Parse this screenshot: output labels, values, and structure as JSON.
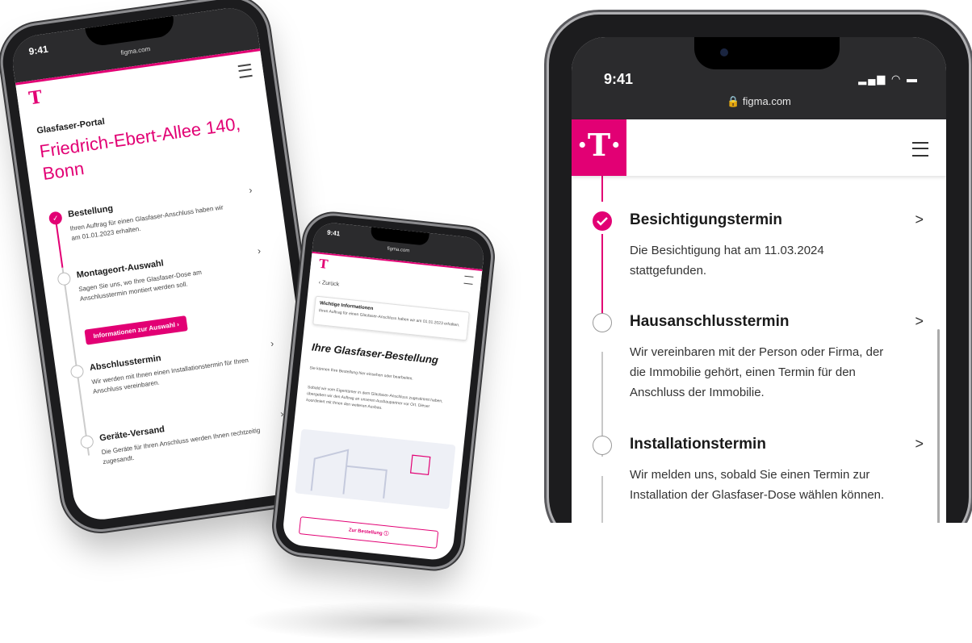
{
  "colors": {
    "brand": "#e20074",
    "frame": "#1c1c1e"
  },
  "phone_left": {
    "time": "9:41",
    "url": "figma.com",
    "portal_label": "Glasfaser-Portal",
    "address": "Friedrich-Ebert-Allee 140, Bonn",
    "steps": [
      {
        "title": "Bestellung",
        "desc": "Ihren Auftrag für einen Glasfaser-Anschluss haben wir am 01.01.2023 erhalten.",
        "status": "done"
      },
      {
        "title": "Montageort-Auswahl",
        "desc": "Sagen Sie uns, wo Ihre Glasfaser-Dose am Anschlusstermin montiert werden soll.",
        "status": "open"
      },
      {
        "title": "Abschlusstermin",
        "desc": "Wir werden mit Ihnen einen Installationstermin für Ihren Anschluss vereinbaren.",
        "status": "open"
      },
      {
        "title": "Geräte-Versand",
        "desc": "Die Geräte für Ihren Anschluss werden Ihnen rechtzeitig zugesandt.",
        "status": "open"
      }
    ],
    "info_button": "Informationen zur Auswahl  ›"
  },
  "phone_middle": {
    "time": "9:41",
    "url": "figma.com",
    "back": "‹  Zurück",
    "info_title": "Wichtige Informationen",
    "info_text": "Ihren Auftrag für einen Glasfaser-Anschluss haben wir am 01.01.2023 erhalten.",
    "heading": "Ihre Glasfaser-Bestellung",
    "para1": "Sie können Ihre Bestellung hier einsehen oder bearbeiten.",
    "para2": "Sobald wir vom Eigentümer in dem Glasfaser-Anschluss zugestimmt haben, übergeben wir den Auftrag an unseren Ausbaupartner vor Ort. Dieser koordiniert mit Ihnen den weiteren Ausbau.",
    "button": "Zur Bestellung  ⓘ"
  },
  "phone_right": {
    "time": "9:41",
    "url": "figma.com",
    "steps": [
      {
        "title": "Besichtigungstermin",
        "desc": "Die Besichtigung hat am 11.03.2024 stattgefunden.",
        "status": "done"
      },
      {
        "title": "Hausanschlusstermin",
        "desc": "Wir vereinbaren mit der Person oder Firma, der die Immobilie gehört, einen Termin für den Anschluss der Immobilie.",
        "status": "open"
      },
      {
        "title": "Installationstermin",
        "desc": "Wir melden uns, sobald Sie einen Termin zur Installation der Glasfaser-Dose wählen können.",
        "status": "open"
      }
    ]
  }
}
